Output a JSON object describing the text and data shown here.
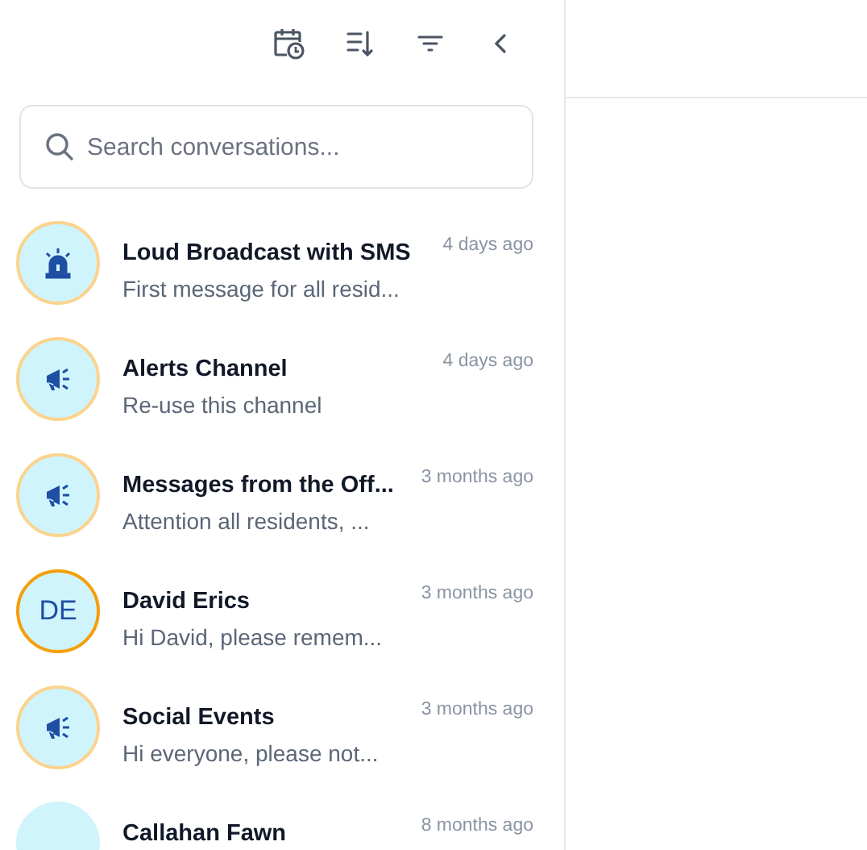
{
  "search": {
    "placeholder": "Search conversations..."
  },
  "conversations": [
    {
      "kind": "siren",
      "title": "Loud Broadcast with SMS",
      "preview": "First message for all resid...",
      "time": "4 days ago",
      "color": "#fcd38d"
    },
    {
      "kind": "megaphone",
      "title": "Alerts Channel",
      "preview": "Re-use this channel",
      "time": "4 days ago",
      "color": "#fcd38d"
    },
    {
      "kind": "megaphone",
      "title": "Messages from the Off...",
      "preview": "Attention all residents, ...",
      "time": "3 months ago",
      "color": "#fcd38d"
    },
    {
      "kind": "initials",
      "initials": "DE",
      "title": "David Erics",
      "preview": "Hi David, please remem...",
      "time": "3 months ago",
      "color": "#f59e0b"
    },
    {
      "kind": "megaphone",
      "title": "Social Events",
      "preview": "Hi everyone, please not...",
      "time": "3 months ago",
      "color": "#fcd38d"
    },
    {
      "kind": "initials",
      "title": "Callahan Fawn",
      "time": "8 months ago"
    }
  ]
}
